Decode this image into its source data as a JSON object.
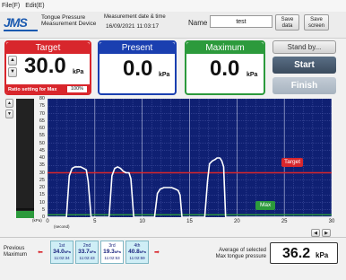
{
  "menu": {
    "file": "File(F)",
    "edit": "Edit(E)"
  },
  "header": {
    "logo": "JMS",
    "app_line1": "Tongue Pressure",
    "app_line2": "Measurement Device",
    "meas_label": "Measurement date & time",
    "meas_value": "16/09/2021 11:03:17",
    "name_label": "Name",
    "name_value": "test",
    "save_data_1": "Save",
    "save_data_2": "data",
    "save_screen_1": "Save",
    "save_screen_2": "screen"
  },
  "panels": {
    "target": {
      "label": "Target",
      "value": "30.0",
      "unit": "kPa",
      "ratio_label": "Ratio setting for Max",
      "ratio_value": "100%"
    },
    "present": {
      "label": "Present",
      "value": "0.0",
      "unit": "kPa"
    },
    "maximum": {
      "label": "Maximum",
      "value": "0.0",
      "unit": "kPa"
    }
  },
  "buttons": {
    "standby": "Stand by...",
    "start": "Start",
    "finish": "Finish"
  },
  "colors": {
    "target_red": "#d8262c",
    "present_blue": "#1a3fb0",
    "maximum_green": "#2c9a3c",
    "grid_bg": "#0f2073",
    "trace": "#ffffff"
  },
  "chart_data": {
    "type": "line",
    "y_unit": "(kPa)",
    "x_unit": "(second)",
    "ylim": [
      0,
      80
    ],
    "xlim": [
      0,
      30
    ],
    "y_ticks": [
      "80",
      "75",
      "70",
      "65",
      "60",
      "55",
      "50",
      "45",
      "40",
      "35",
      "30",
      "25",
      "20",
      "15",
      "10",
      "5",
      "0"
    ],
    "x_ticks": [
      "0",
      "5",
      "10",
      "15",
      "20",
      "25",
      "30"
    ],
    "target_line": 30,
    "target_label": "Target",
    "max_label": "Max",
    "max_value_fraction": 0.98,
    "series": [
      {
        "x": [
          0,
          2,
          2.3,
          2.6,
          2.9,
          3.2,
          3.5,
          3.8,
          4.1,
          4.3,
          4.6,
          6.5,
          6.8,
          7.1,
          7.4,
          7.7,
          8.0,
          8.3,
          8.6,
          8.8,
          9.1,
          11.3,
          11.6,
          11.9,
          12.3,
          12.7,
          13.1,
          13.5,
          13.8,
          14.0,
          14.2,
          16.6,
          16.9,
          17.1,
          17.4,
          17.7,
          17.9,
          18.2,
          18.4,
          18.6,
          18.8,
          30
        ],
        "y": [
          0,
          0,
          28,
          33,
          34,
          34,
          34,
          33,
          32,
          24,
          0,
          0,
          28,
          33,
          34,
          33,
          31,
          30,
          30,
          26,
          0,
          0,
          16,
          19,
          20,
          20,
          20,
          19,
          18,
          15,
          0,
          0,
          25,
          36,
          38,
          39,
          40,
          40,
          38,
          34,
          0,
          0
        ]
      }
    ]
  },
  "bottom": {
    "previous_1": "Previous",
    "previous_2": "Maximum",
    "cards": [
      {
        "rank": "1st",
        "value": "34.0",
        "unit": "kPa",
        "time": "11:02:34"
      },
      {
        "rank": "2nd",
        "value": "33.7",
        "unit": "kPa",
        "time": "11:02:43"
      },
      {
        "rank": "3rd",
        "value": "19.3",
        "unit": "kPa",
        "time": "11:02:53"
      },
      {
        "rank": "4th",
        "value": "40.8",
        "unit": "kPa",
        "time": "11:02:59"
      }
    ],
    "average_1": "Average of selected",
    "average_2": "Max tongue pressure",
    "average_value": "36.2",
    "average_unit": "kPa"
  }
}
